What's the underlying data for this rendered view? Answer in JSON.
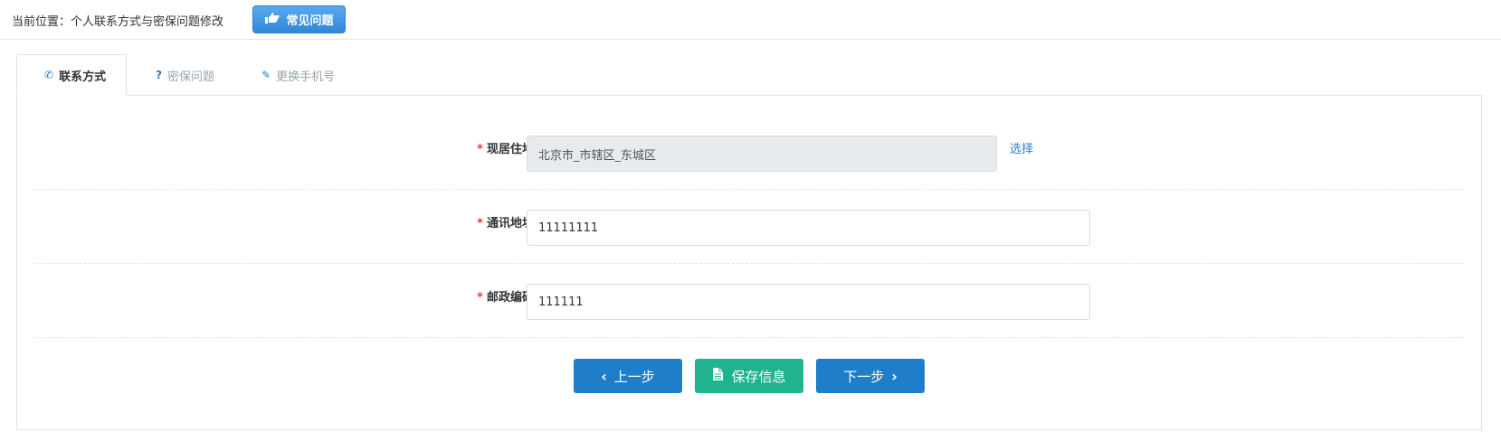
{
  "breadcrumb": "当前位置：个人联系方式与密保问题修改",
  "faq_button": {
    "label": "常见问题",
    "icon": "hand-pointer-icon"
  },
  "tabs": [
    {
      "label": "联系方式",
      "icon": "phone-icon",
      "glyph": "✆"
    },
    {
      "label": "密保问题",
      "icon": "question-icon",
      "glyph": "?"
    },
    {
      "label": "更换手机号",
      "icon": "pencil-icon",
      "glyph": "✎"
    }
  ],
  "form": {
    "required_mark": "*",
    "residence": {
      "label": "现居住地",
      "value": "北京市_市辖区_东城区",
      "action": "选择"
    },
    "address": {
      "label": "通讯地址",
      "value": "11111111"
    },
    "postcode": {
      "label": "邮政编码",
      "value": "111111"
    }
  },
  "buttons": {
    "prev": "上一步",
    "save": "保存信息",
    "next": "下一步"
  },
  "colors": {
    "primary": "#1f7ec9",
    "success": "#1fb38f",
    "required": "#e23a3a",
    "link": "#1d7fd6"
  }
}
